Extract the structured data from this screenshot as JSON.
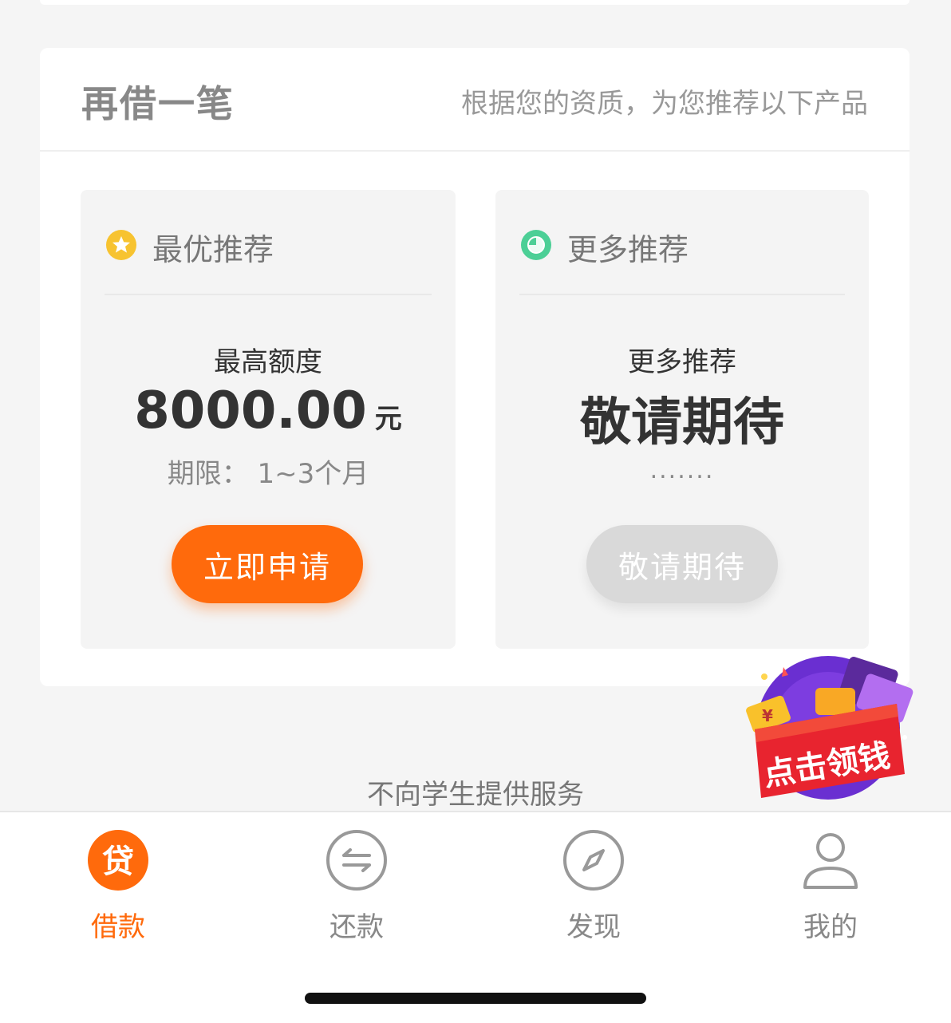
{
  "section": {
    "title": "再借一笔",
    "subtitle": "根据您的资质，为您推荐以下产品"
  },
  "best": {
    "head_label": "最优推荐",
    "amount_label": "最高额度",
    "amount": "8000.00",
    "unit": "元",
    "term": "期限：  1~3个月",
    "button": "立即申请"
  },
  "more": {
    "head_label": "更多推荐",
    "line1": "更多推荐",
    "big": "敬请期待",
    "dots": ".......",
    "button": "敬请期待"
  },
  "promo": {
    "label": "点击领钱"
  },
  "footer_note": "不向学生提供服务",
  "tabs": [
    {
      "label": "借款",
      "icon": "loan-icon",
      "glyph": "贷",
      "active": true
    },
    {
      "label": "还款",
      "icon": "repay-icon",
      "active": false
    },
    {
      "label": "发现",
      "icon": "compass-icon",
      "active": false
    },
    {
      "label": "我的",
      "icon": "user-icon",
      "active": false
    }
  ],
  "colors": {
    "accent": "#ff6a0c",
    "star": "#f7c330",
    "clock": "#4ccf96",
    "disabled": "#d9d9d9"
  }
}
